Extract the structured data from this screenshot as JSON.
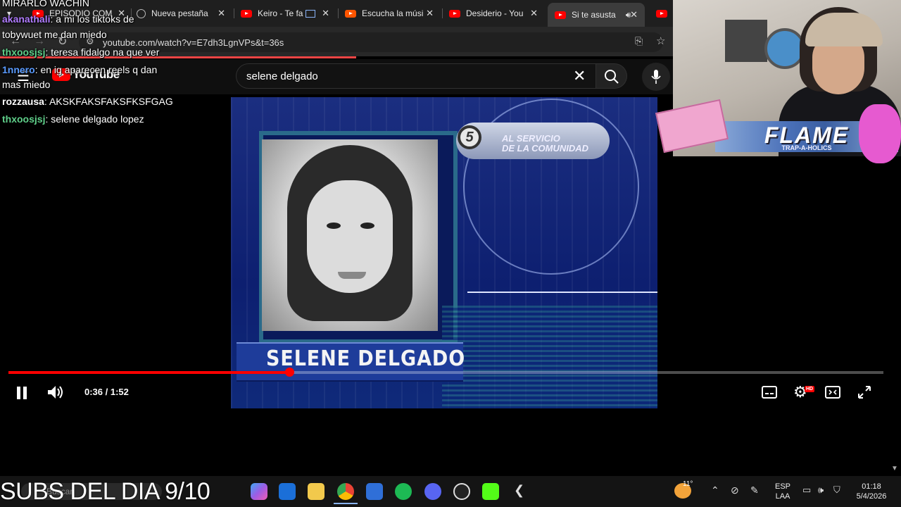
{
  "browser": {
    "tabs": [
      {
        "label": "EPISODIO COM",
        "icon": "youtube-icon"
      },
      {
        "label": "Nueva pestaña",
        "icon": "globe-icon"
      },
      {
        "label": "Keiro - Te fa",
        "icon": "youtube-icon"
      },
      {
        "label": "Escucha la músi",
        "icon": "soundcloud-icon"
      },
      {
        "label": "Desiderio - You",
        "icon": "youtube-icon"
      },
      {
        "label": "Si te asusta",
        "icon": "youtube-icon"
      }
    ],
    "url": "youtube.com/watch?v=E7dh3LgnVPs&t=36s"
  },
  "youtube": {
    "logo_text": "YouTube",
    "search_value": "selene delgado"
  },
  "video": {
    "badge_number": "5",
    "badge_text_line1": "AL SERVICIO",
    "badge_text_line2": "DE LA COMUNIDAD",
    "caption_name": "SELENE DELGADO"
  },
  "player": {
    "current_time": "0:36",
    "duration": "1:52",
    "time_display": "0:36 / 1:52",
    "progress_fraction": 0.321,
    "hd_badge": "HD"
  },
  "chat": {
    "header": "MIRARLO WACHIN",
    "messages": [
      {
        "user": "akanathali",
        "text": "a mi los tiktoks de",
        "color": "#b07cff"
      },
      {
        "user": "",
        "text": "tobywuet me dan miedo",
        "color": "#ffffff"
      },
      {
        "user": "thxoosjsj",
        "text": "teresa fidalgo na que ver",
        "color": "#5fd08a"
      },
      {
        "user": "1nnero",
        "text": "en ig aparecen reels q dan",
        "color": "#5a9bff"
      },
      {
        "user": "",
        "text": "mas miedo",
        "color": "#ffffff"
      },
      {
        "user": "rozzausa",
        "text": "AKSKFAKSFAKSFKSFGAG",
        "color": "#ffffff"
      },
      {
        "user": "thxoosjsj",
        "text": "selene delgado lopez",
        "color": "#5fd08a"
      }
    ]
  },
  "webcam": {
    "overlay_title": "FLAME",
    "overlay_subtitle": "TRAP-A-HOLICS"
  },
  "taskbar": {
    "subs_overlay": "SUBS DEL DIA 9/10",
    "search_placeholder": "Buscar",
    "weather": "11°",
    "lang_line1": "ESP",
    "lang_line2": "LAA",
    "time": "01:18",
    "date": "5/4/2026"
  }
}
